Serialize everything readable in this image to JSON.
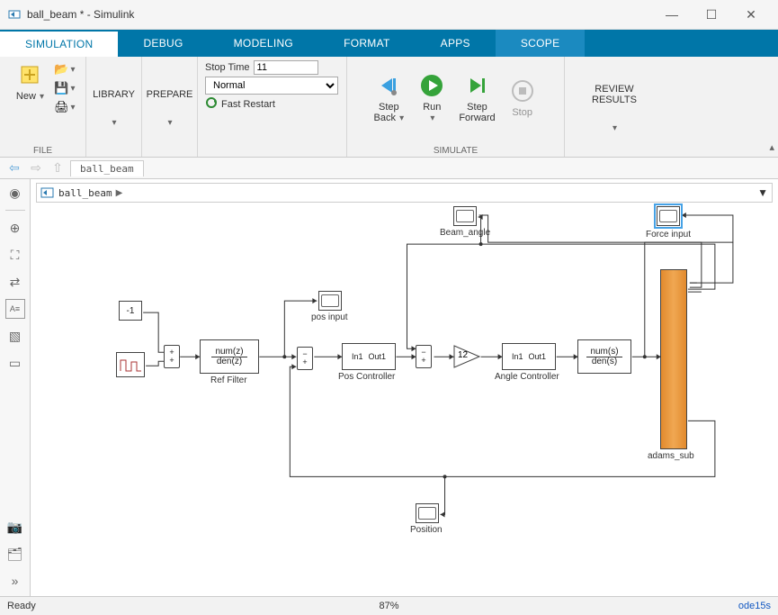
{
  "window": {
    "title": "ball_beam * - Simulink"
  },
  "ribbon": {
    "tabs": [
      "SIMULATION",
      "DEBUG",
      "MODELING",
      "FORMAT",
      "APPS",
      "SCOPE"
    ],
    "active_tab": "SIMULATION"
  },
  "toolstrip": {
    "file_group": "FILE",
    "new_label": "New",
    "library_label": "LIBRARY",
    "prepare_label": "PREPARE",
    "stop_time_label": "Stop Time",
    "stop_time_value": "11",
    "mode_value": "Normal",
    "fast_restart": "Fast Restart",
    "simulate_group": "SIMULATE",
    "step_back": "Step\nBack",
    "run": "Run",
    "step_forward": "Step\nForward",
    "stop": "Stop",
    "review_results": "REVIEW RESULTS"
  },
  "nav": {
    "model_tab": "ball_beam"
  },
  "breadcrumb": {
    "model_name": "ball_beam"
  },
  "blocks": {
    "const_neg1": "-1",
    "ref_filter_num": "num(z)",
    "ref_filter_den": "den(z)",
    "ref_filter_label": "Ref Filter",
    "pos_input_label": "pos input",
    "pos_controller_in": "In1",
    "pos_controller_out": "Out1",
    "pos_controller_label": "Pos Controller",
    "gain_value": "12",
    "angle_controller_in": "In1",
    "angle_controller_out": "Out1",
    "angle_controller_label": "Angle Controller",
    "tf_num": "num(s)",
    "tf_den": "den(s)",
    "beam_angle_label": "Beam_angle",
    "force_input_label": "Force input",
    "adams_sub_label": "adams_sub",
    "position_label": "Position"
  },
  "status": {
    "ready": "Ready",
    "zoom": "87%",
    "solver": "ode15s"
  }
}
